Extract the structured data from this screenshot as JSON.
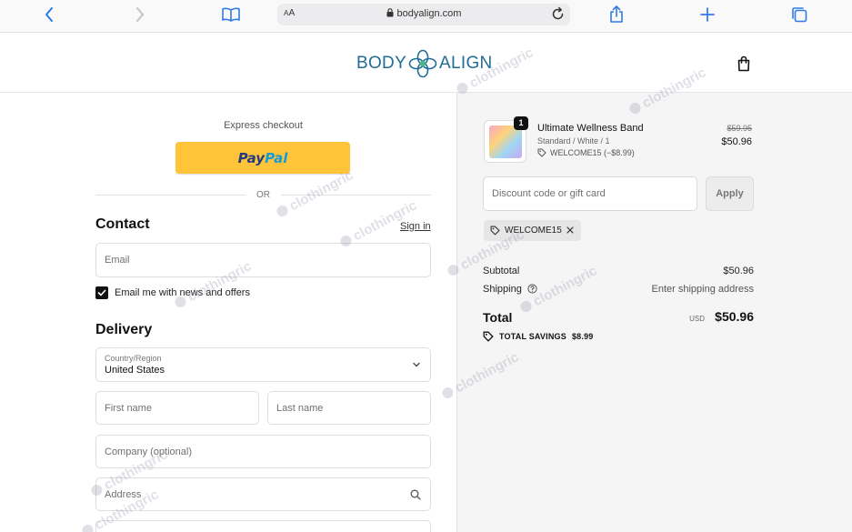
{
  "browser": {
    "text_size_label": "AA",
    "url": "bodyalign.com"
  },
  "header": {
    "logo_left": "BODY",
    "logo_right": "ALIGN",
    "brand_color": "#1f6d96"
  },
  "checkout": {
    "express_label": "Express checkout",
    "paypal_pay": "Pay",
    "paypal_pal": "Pal",
    "or_label": "OR",
    "contact_title": "Contact",
    "signin_label": "Sign in",
    "email_placeholder": "Email",
    "newsletter_label": "Email me with news and offers",
    "newsletter_checked": true,
    "delivery_title": "Delivery",
    "country_label": "Country/Region",
    "country_value": "United States",
    "first_name_placeholder": "First name",
    "last_name_placeholder": "Last name",
    "company_placeholder": "Company (optional)",
    "address_placeholder": "Address"
  },
  "summary": {
    "item": {
      "quantity": "1",
      "name": "Ultimate Wellness Band",
      "variant": "Standard / White / 1",
      "discount": "WELCOME15 (−$8.99)",
      "price_original": "$59.95",
      "price_final": "$50.96"
    },
    "discount_placeholder": "Discount code or gift card",
    "apply_label": "Apply",
    "applied_code": "WELCOME15",
    "subtotal_label": "Subtotal",
    "subtotal_value": "$50.96",
    "shipping_label": "Shipping",
    "shipping_value": "Enter shipping address",
    "total_label": "Total",
    "total_currency": "USD",
    "total_value": "$50.96",
    "savings_label": "TOTAL SAVINGS",
    "savings_value": "$8.99"
  },
  "watermark": "clothingric",
  "colors": {
    "paypal_yellow": "#ffc439",
    "paypal_dark_blue": "#253b80",
    "paypal_light_blue": "#179bd7",
    "browser_accent": "#2f7be8"
  }
}
